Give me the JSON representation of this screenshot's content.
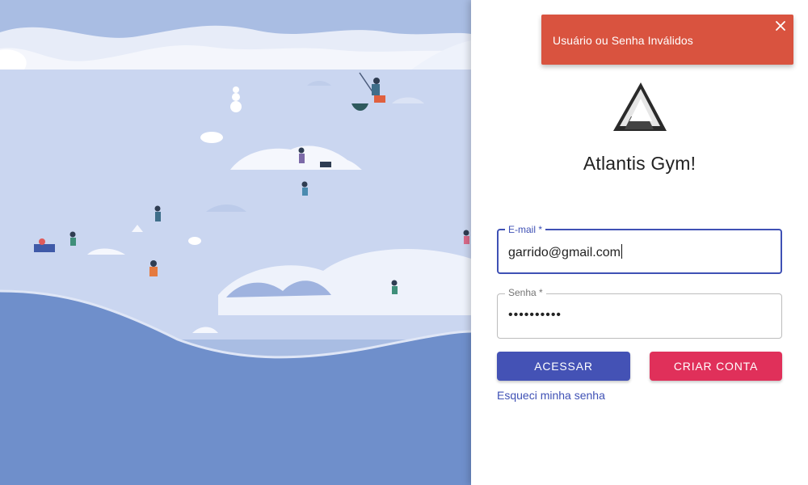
{
  "toast": {
    "message": "Usuário ou Senha Inválidos",
    "close_icon": "close-icon",
    "color": "#d9533f"
  },
  "brand": {
    "logo_icon": "atlantis-triangle-logo-icon",
    "title": "Atlantis Gym!"
  },
  "form": {
    "email": {
      "label": "E-mail *",
      "value": "garrido@gmail.com"
    },
    "password": {
      "label": "Senha *",
      "value": "••••••••••"
    },
    "login_button": "ACESSAR",
    "signup_button": "CRIAR CONTA",
    "forgot_link": "Esqueci minha senha"
  },
  "colors": {
    "primary": "#3f51b5",
    "secondary": "#e0305a",
    "sky": "#a9bde3",
    "ice": "#cbd7ef",
    "water": "#6f8fcb"
  }
}
